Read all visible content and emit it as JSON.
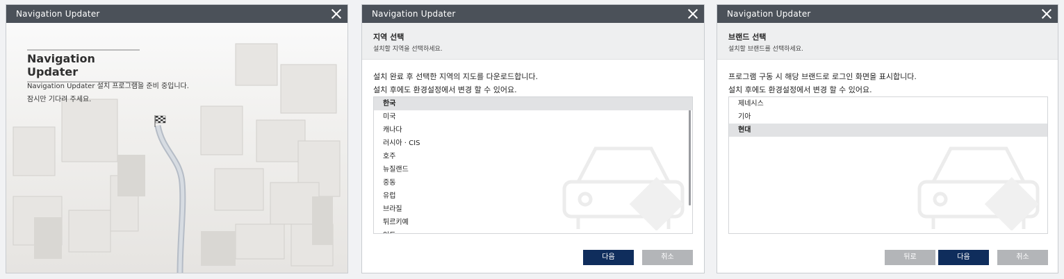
{
  "splash_window": {
    "title": "Navigation Updater",
    "heading": "Navigation Updater",
    "line1": "Navigation Updater 설치 프로그램을 준비 중입니다.",
    "line2": "잠시만 기다려 주세요."
  },
  "region_window": {
    "title": "Navigation Updater",
    "header_title": "지역 선택",
    "header_subtitle": "설치할 지역을 선택하세요.",
    "description_line1": "설치 완료 후 선택한 지역의 지도를 다운로드합니다.",
    "description_line2": "설치 후에도 환경설정에서 변경 할 수 있어요.",
    "selected": "한국",
    "items": [
      "한국",
      "미국",
      "캐나다",
      "러시아 · CIS",
      "호주",
      "뉴질랜드",
      "중동",
      "유럽",
      "브라질",
      "튀르키예",
      "인도"
    ],
    "next_label": "다음",
    "cancel_label": "취소"
  },
  "brand_window": {
    "title": "Navigation Updater",
    "header_title": "브랜드 선택",
    "header_subtitle": "설치할 브랜드를 선택하세요.",
    "description_line1": "프로그램 구동 시 해당 브랜드로 로그인 화면을 표시합니다.",
    "description_line2": "설치 후에도 환경설정에서 변경 할 수 있어요.",
    "selected": "현대",
    "items": [
      "제네시스",
      "기아",
      "현대"
    ],
    "back_label": "뒤로",
    "next_label": "다음",
    "cancel_label": "취소"
  },
  "colors": {
    "titlebar": "#4b5159",
    "primary_button": "#0f2d5c",
    "secondary_button": "#b3b5b8",
    "selected_row": "#e1e2e4"
  },
  "icons": [
    "close-icon",
    "car-icon",
    "checkered-flag-icon"
  ]
}
